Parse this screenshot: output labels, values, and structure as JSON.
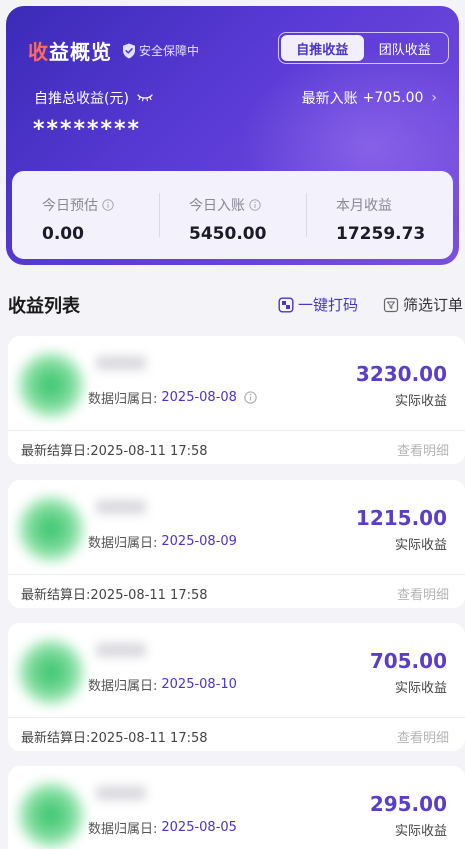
{
  "header": {
    "title_part1": "收",
    "title_part2": "益概览",
    "safety_text": "安全保障中",
    "tabs": [
      {
        "label": "自推收益",
        "active": true
      },
      {
        "label": "团队收益",
        "active": false
      }
    ],
    "total_label": "自推总收益(元)",
    "latest_label": "最新入账",
    "latest_value": "+705.00",
    "masked_total": "********"
  },
  "stats": [
    {
      "label": "今日预估",
      "value": "0.00",
      "has_info": true
    },
    {
      "label": "今日入账",
      "value": "5450.00",
      "has_info": true
    },
    {
      "label": "本月收益",
      "value": "17259.73",
      "has_info": false
    }
  ],
  "list": {
    "title": "收益列表",
    "print_label": "一键打码",
    "filter_label": "筛选订单"
  },
  "cards": [
    {
      "date_label": "数据归属日:",
      "date": "2025-08-08",
      "amount": "3230.00",
      "amount_label": "实际收益",
      "settle": "最新结算日:2025-08-11 17:58",
      "detail": "查看明细"
    },
    {
      "date_label": "数据归属日:",
      "date": "2025-08-09",
      "amount": "1215.00",
      "amount_label": "实际收益",
      "settle": "最新结算日:2025-08-11 17:58",
      "detail": "查看明细"
    },
    {
      "date_label": "数据归属日:",
      "date": "2025-08-10",
      "amount": "705.00",
      "amount_label": "实际收益",
      "settle": "最新结算日:2025-08-11 17:58",
      "detail": "查看明细"
    },
    {
      "date_label": "数据归属日:",
      "date": "2025-08-05",
      "amount": "295.00",
      "amount_label": "实际收益",
      "settle": "",
      "detail": ""
    }
  ],
  "colors": {
    "accent": "#4a36c4",
    "amount": "#5a3ec8",
    "hero_start": "#3b2ab8",
    "hero_end": "#7a4fe0"
  },
  "icons": [
    "shield-check-icon",
    "eye-closed-icon",
    "chevron-right-icon",
    "info-icon",
    "mosaic-icon",
    "filter-icon"
  ]
}
